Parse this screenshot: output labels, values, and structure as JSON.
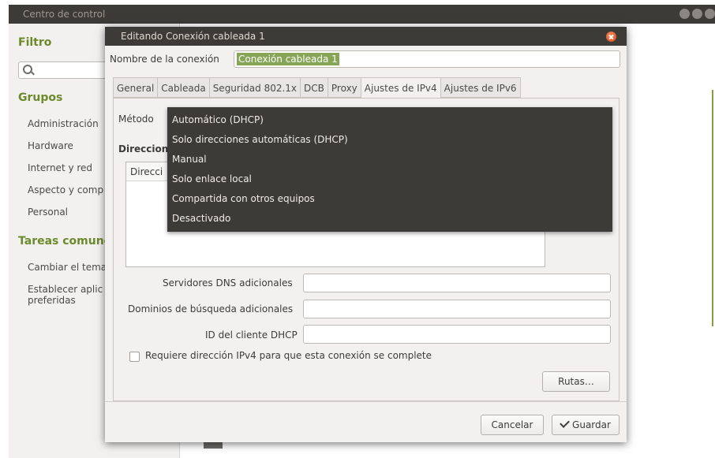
{
  "control_center": {
    "title": "Centro de control",
    "sidebar": {
      "filter_heading": "Filtro",
      "groups_heading": "Grupos",
      "groups": [
        "Administración",
        "Hardware",
        "Internet y red",
        "Aspecto y comp",
        "Personal"
      ],
      "tasks_heading": "Tareas comune",
      "tasks": [
        "Cambiar el tema",
        "Establecer aplic",
        "preferidas"
      ]
    }
  },
  "dialog": {
    "title": "Editando Conexión cableada 1",
    "connection_name_label": "Nombre de la conexión",
    "connection_name_value": "Conexión cableada 1",
    "tabs": [
      "General",
      "Cableada",
      "Seguridad 802.1x",
      "DCB",
      "Proxy",
      "Ajustes de IPv4",
      "Ajustes de IPv6"
    ],
    "active_tab": "Ajustes de IPv4",
    "method_label": "Método",
    "addresses_heading": "Direccion",
    "addresses_column": "Direcci",
    "dns_label": "Servidores DNS adicionales",
    "search_domains_label": "Dominios de búsqueda adicionales",
    "dhcp_client_id_label": "ID del cliente DHCP",
    "require_ipv4_label": "Requiere dirección IPv4 para que esta conexión se complete",
    "require_ipv4_checked": false,
    "routes_button": "Rutas…",
    "cancel_button": "Cancelar",
    "save_button": "Guardar"
  },
  "method_menu": {
    "items": [
      "Automático (DHCP)",
      "Solo direcciones automáticas (DHCP)",
      "Manual",
      "Solo enlace local",
      "Compartida con otros equipos",
      "Desactivado"
    ]
  },
  "colors": {
    "titlebar": "#3d3b37",
    "accent_green": "#6c8a2a",
    "selection_green": "#87a556",
    "close_orange": "#dd4814",
    "menu_bg": "#3c3b37"
  }
}
